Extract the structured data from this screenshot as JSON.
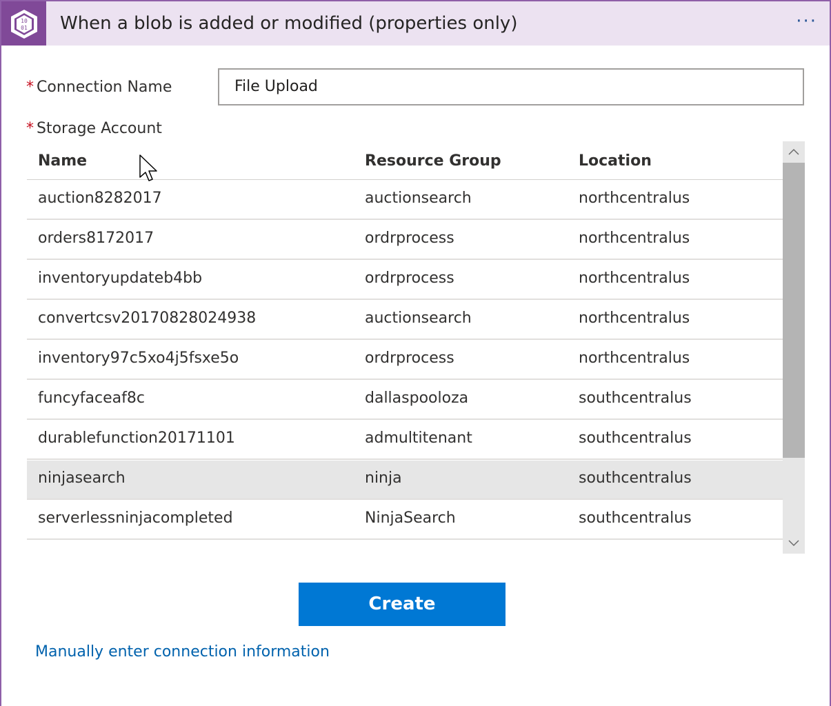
{
  "header": {
    "title": "When a blob is added or modified (properties only)",
    "menu_label": "···",
    "icon": "blob-storage-icon",
    "accent": "#804998"
  },
  "form": {
    "connection_name_label": "Connection Name",
    "connection_name_value": "File Upload",
    "storage_account_label": "Storage Account",
    "required_marker": "*"
  },
  "table": {
    "columns": [
      "Name",
      "Resource Group",
      "Location"
    ],
    "rows": [
      {
        "name": "auction8282017",
        "group": "auctionsearch",
        "location": "northcentralus"
      },
      {
        "name": "orders8172017",
        "group": "ordrprocess",
        "location": "northcentralus"
      },
      {
        "name": "inventoryupdateb4bb",
        "group": "ordrprocess",
        "location": "northcentralus"
      },
      {
        "name": "convertcsv20170828024938",
        "group": "auctionsearch",
        "location": "northcentralus"
      },
      {
        "name": "inventory97c5xo4j5fsxe5o",
        "group": "ordrprocess",
        "location": "northcentralus"
      },
      {
        "name": "funcyfaceaf8c",
        "group": "dallaspooloza",
        "location": "southcentralus"
      },
      {
        "name": "durablefunction20171101",
        "group": "admultitenant",
        "location": "southcentralus"
      },
      {
        "name": "ninjasearch",
        "group": "ninja",
        "location": "southcentralus"
      },
      {
        "name": "serverlessninjacompleted",
        "group": "NinjaSearch",
        "location": "southcentralus"
      }
    ],
    "selected_index": 7
  },
  "actions": {
    "create_label": "Create",
    "manual_link": "Manually enter connection information",
    "button_color": "#0078d4"
  }
}
